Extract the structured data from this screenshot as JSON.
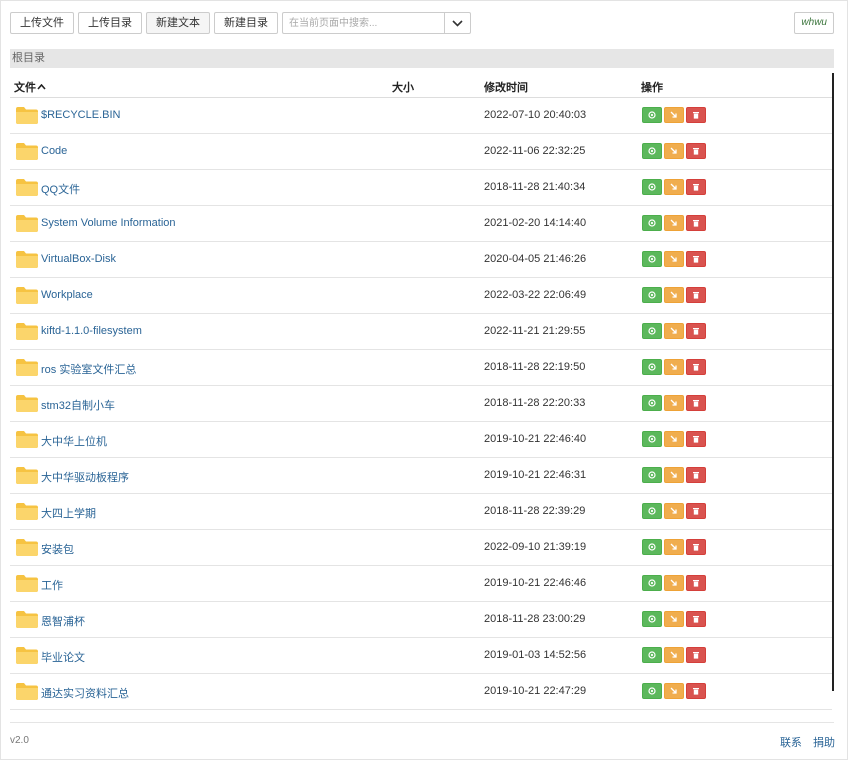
{
  "toolbar": {
    "upload_file": "上传文件",
    "upload_dir": "上传目录",
    "new_text": "新建文本",
    "new_dir": "新建目录",
    "search_placeholder": "在当前页面中搜索...",
    "user": "whwu"
  },
  "breadcrumb": "根目录",
  "columns": {
    "file": "文件",
    "size": "大小",
    "modified": "修改时间",
    "actions": "操作"
  },
  "rows": [
    {
      "name": "$RECYCLE.BIN",
      "size": "",
      "date": "2022-07-10 20:40:03"
    },
    {
      "name": "Code",
      "size": "",
      "date": "2022-11-06 22:32:25"
    },
    {
      "name": "QQ文件",
      "size": "",
      "date": "2018-11-28 21:40:34"
    },
    {
      "name": "System Volume Information",
      "size": "",
      "date": "2021-02-20 14:14:40"
    },
    {
      "name": "VirtualBox-Disk",
      "size": "",
      "date": "2020-04-05 21:46:26"
    },
    {
      "name": "Workplace",
      "size": "",
      "date": "2022-03-22 22:06:49"
    },
    {
      "name": "kiftd-1.1.0-filesystem",
      "size": "",
      "date": "2022-11-21 21:29:55"
    },
    {
      "name": "ros 实验室文件汇总",
      "size": "",
      "date": "2018-11-28 22:19:50"
    },
    {
      "name": "stm32自制小车",
      "size": "",
      "date": "2018-11-28 22:20:33"
    },
    {
      "name": "大中华上位机",
      "size": "",
      "date": "2019-10-21 22:46:40"
    },
    {
      "name": "大中华驱动板程序",
      "size": "",
      "date": "2019-10-21 22:46:31"
    },
    {
      "name": "大四上学期",
      "size": "",
      "date": "2018-11-28 22:39:29"
    },
    {
      "name": "安装包",
      "size": "",
      "date": "2022-09-10 21:39:19"
    },
    {
      "name": "工作",
      "size": "",
      "date": "2019-10-21 22:46:46"
    },
    {
      "name": "恩智浦杯",
      "size": "",
      "date": "2018-11-28 23:00:29"
    },
    {
      "name": "毕业论文",
      "size": "",
      "date": "2019-01-03 14:52:56"
    },
    {
      "name": "通达实习资料汇总",
      "size": "",
      "date": "2019-10-21 22:47:29"
    }
  ],
  "row_icons": {
    "folder": "folder-icon",
    "view": "eye-icon",
    "move": "move-icon",
    "delete": "trash-icon"
  },
  "colors": {
    "link": "#2a6496",
    "folder": "#f6c342",
    "view_button": "#5cb85c",
    "move_button": "#f0ad4e",
    "delete_button": "#d9534f"
  },
  "footer": {
    "version": "v2.0",
    "contact": "联系",
    "donate": "捐助"
  }
}
